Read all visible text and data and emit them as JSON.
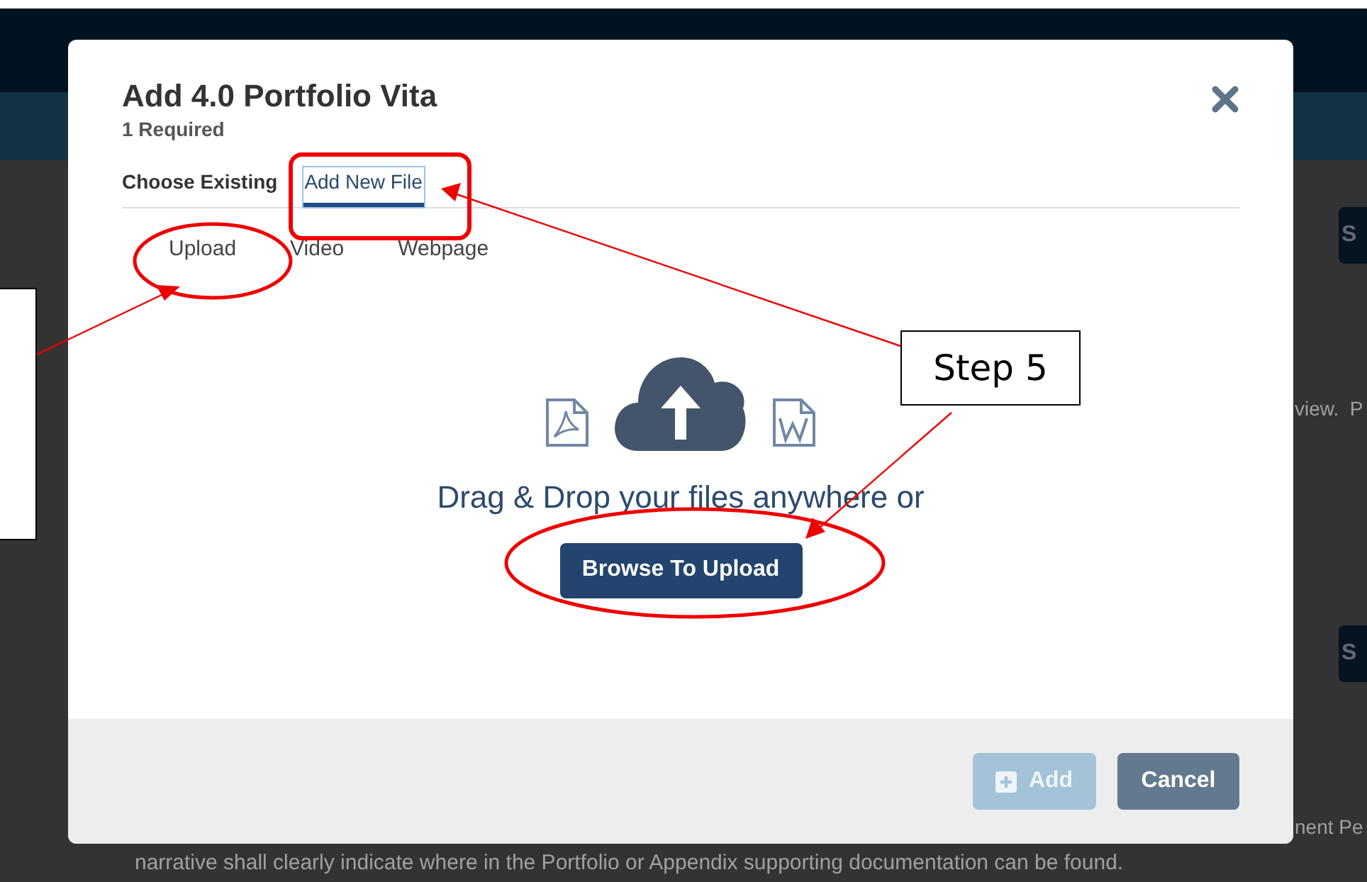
{
  "background": {
    "button_labels": [
      "S",
      "S"
    ],
    "texts": [
      "view.  P",
      "nent Pe"
    ],
    "footnote": "narrative shall clearly indicate where in the Portfolio or Appendix supporting documentation can be found."
  },
  "modal": {
    "title": "Add 4.0 Portfolio Vita",
    "subtitle": "1 Required",
    "tabs": [
      {
        "label": "Choose Existing",
        "selected": false
      },
      {
        "label": "Add New File",
        "selected": true
      }
    ],
    "subtabs": [
      "Upload",
      "Video",
      "Webpage"
    ],
    "dropzone": {
      "text": "Drag & Drop your files anywhere or",
      "button": "Browse To Upload"
    },
    "footer": [
      {
        "kind": "add",
        "label": "Add",
        "disabled": true
      },
      {
        "kind": "cancel",
        "label": "Cancel",
        "disabled": false
      }
    ]
  },
  "annotation": {
    "step_label": "Step 5"
  }
}
